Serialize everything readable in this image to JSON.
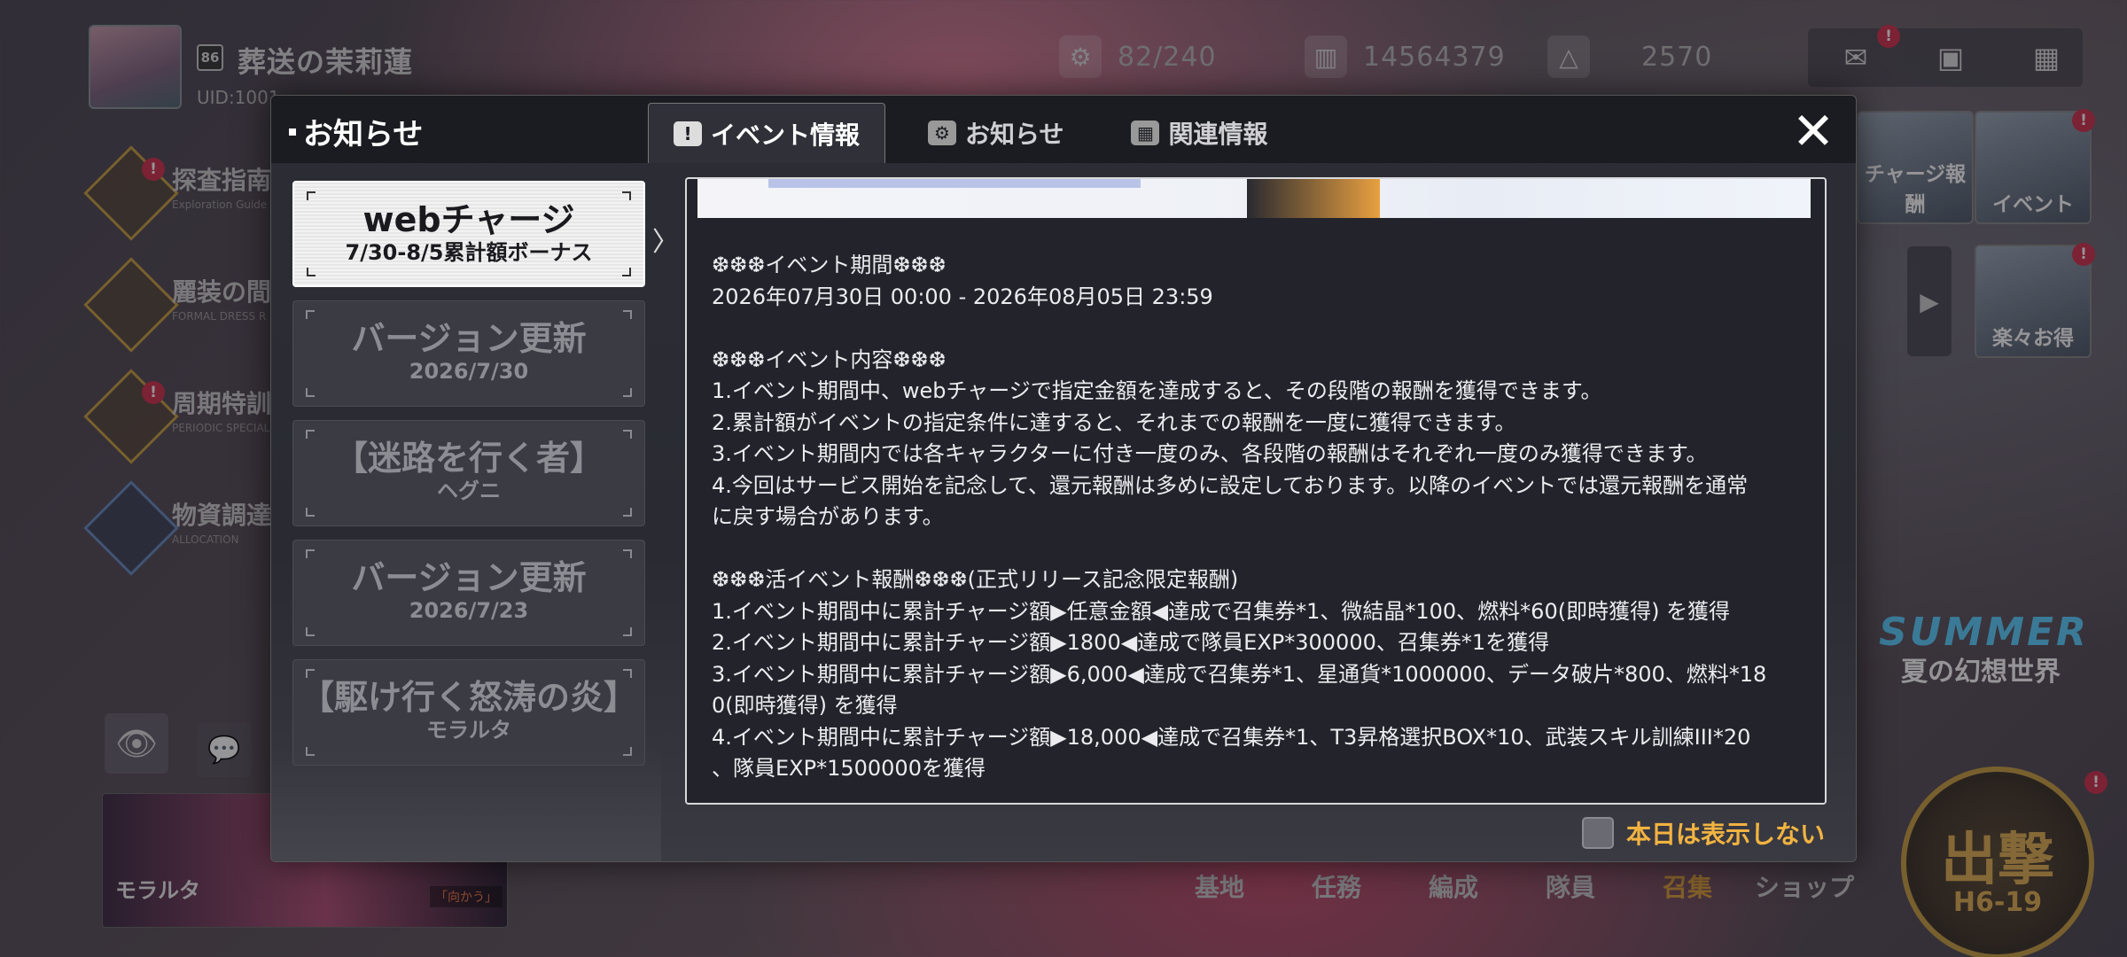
{
  "hud": {
    "level": "86",
    "player_name": "葬送の茉莉蓮",
    "uid_label": "UID:1001",
    "resources": [
      {
        "icon": "gear-icon",
        "value": "82/240"
      },
      {
        "icon": "chip-icon",
        "value": "14564379"
      },
      {
        "icon": "triangle-icon",
        "value": "2570"
      }
    ],
    "side_menu": [
      {
        "label": "探査指南",
        "sub": "Exploration Guide"
      },
      {
        "label": "麗装の間",
        "sub": "FORMAL DRESS R"
      },
      {
        "label": "周期特訓",
        "sub": "PERIODIC SPECIAL"
      },
      {
        "label": "物資調達",
        "sub": "ALLOCATION"
      }
    ],
    "right_cards": [
      "チャージ報酬",
      "イベント",
      "楽々お得"
    ],
    "summer_title": "SUMMER",
    "summer_sub": "夏の幻想世界",
    "character_name": "モラルタ",
    "character_tag": "「向かう」",
    "bottom_nav": [
      "基地",
      "任務",
      "編成",
      "隊員",
      "召集",
      "ショップ"
    ],
    "sortie_label": "出撃",
    "sortie_stage": "H6-19"
  },
  "modal": {
    "title": "お知らせ",
    "tabs": [
      {
        "label": "イベント情報",
        "icon": "!"
      },
      {
        "label": "お知らせ",
        "icon": "⚙"
      },
      {
        "label": "関連情報",
        "icon": "▦"
      }
    ],
    "list": [
      {
        "title": "webチャージ",
        "sub": "7/30-8/5累計額ボーナス"
      },
      {
        "title": "バージョン更新",
        "sub": "2026/7/30"
      },
      {
        "title": "【迷路を行く者】",
        "sub": "ヘグニ"
      },
      {
        "title": "バージョン更新",
        "sub": "2026/7/23"
      },
      {
        "title": "【駆け行く怒涛の炎】",
        "sub": "モラルタ"
      }
    ],
    "content_lines": [
      "❆❆❆イベント期間❆❆❆",
      "2026年07月30日 00:00 - 2026年08月05日 23:59",
      "",
      "❆❆❆イベント内容❆❆❆",
      "1.イベント期間中、webチャージで指定金額を達成すると、その段階の報酬を獲得できます。",
      "2.累計額がイベントの指定条件に達すると、それまでの報酬を一度に獲得できます。",
      "3.イベント期間内では各キャラクターに付き一度のみ、各段階の報酬はそれぞれ一度のみ獲得できます。",
      "4.今回はサービス開始を記念して、還元報酬は多めに設定しております。以降のイベントでは還元報酬を通常",
      "に戻す場合があります。",
      "",
      "❆❆❆活イベント報酬❆❆❆(正式リリース記念限定報酬)",
      "1.イベント期間中に累計チャージ額▶任意金額◀達成で召集券*1、微結晶*100、燃料*60(即時獲得) を獲得",
      "2.イベント期間中に累計チャージ額▶1800◀達成で隊員EXP*300000、召集券*1を獲得",
      "3.イベント期間中に累計チャージ額▶6,000◀達成で召集券*1、星通貨*1000000、データ破片*800、燃料*18",
      "0(即時獲得) を獲得",
      "4.イベント期間中に累計チャージ額▶18,000◀達成で召集券*1、T3昇格選択BOX*10、武装スキル訓練III*20",
      "、隊員EXP*1500000を獲得"
    ],
    "dont_show_today": "本日は表示しない",
    "close_symbol": "✕"
  }
}
